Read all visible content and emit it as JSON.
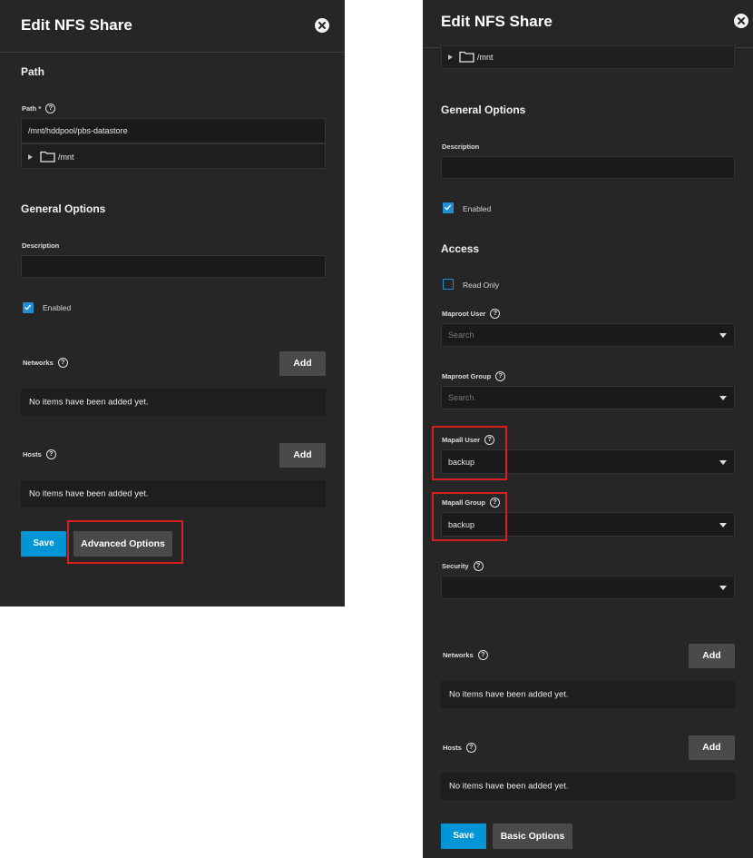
{
  "left": {
    "header": {
      "title": "Edit NFS Share"
    },
    "path_section": {
      "title": "Path",
      "path_label": "Path *",
      "path_value": "/mnt/hddpool/pbs-datastore",
      "tree_item": "/mnt"
    },
    "general": {
      "title": "General Options",
      "description_label": "Description",
      "description_value": "",
      "enabled_label": "Enabled",
      "enabled": true
    },
    "networks": {
      "label": "Networks",
      "add_label": "Add",
      "empty_text": "No items have been added yet."
    },
    "hosts": {
      "label": "Hosts",
      "add_label": "Add",
      "empty_text": "No items have been added yet."
    },
    "actions": {
      "save_label": "Save",
      "advanced_label": "Advanced Options"
    }
  },
  "right": {
    "header": {
      "title": "Edit NFS Share"
    },
    "tree_item": "/mnt",
    "general": {
      "title": "General Options",
      "description_label": "Description",
      "description_value": "",
      "enabled_label": "Enabled",
      "enabled": true
    },
    "access": {
      "title": "Access",
      "read_only_label": "Read Only",
      "read_only": false,
      "maproot_user_label": "Maproot User",
      "maproot_user_placeholder": "Search",
      "maproot_group_label": "Maproot Group",
      "maproot_group_placeholder": "Search",
      "mapall_user_label": "Mapall User",
      "mapall_user_value": "backup",
      "mapall_group_label": "Mapall Group",
      "mapall_group_value": "backup",
      "security_label": "Security",
      "security_value": ""
    },
    "networks": {
      "label": "Networks",
      "add_label": "Add",
      "empty_text": "No items have been added yet."
    },
    "hosts": {
      "label": "Hosts",
      "add_label": "Add",
      "empty_text": "No items have been added yet."
    },
    "actions": {
      "save_label": "Save",
      "basic_label": "Basic Options"
    }
  },
  "icons": {
    "close": "close-circle-icon",
    "help": "help-circle-icon",
    "folder": "folder-icon",
    "expand": "expand-arrow-icon",
    "dropdown": "chevron-down-icon",
    "check": "check-icon"
  },
  "colors": {
    "panel_bg": "#262626",
    "field_bg": "#1a1a1a",
    "accent_blue": "#0095d5",
    "highlight_red": "#d42020",
    "button_grey": "#4a4a4a"
  }
}
